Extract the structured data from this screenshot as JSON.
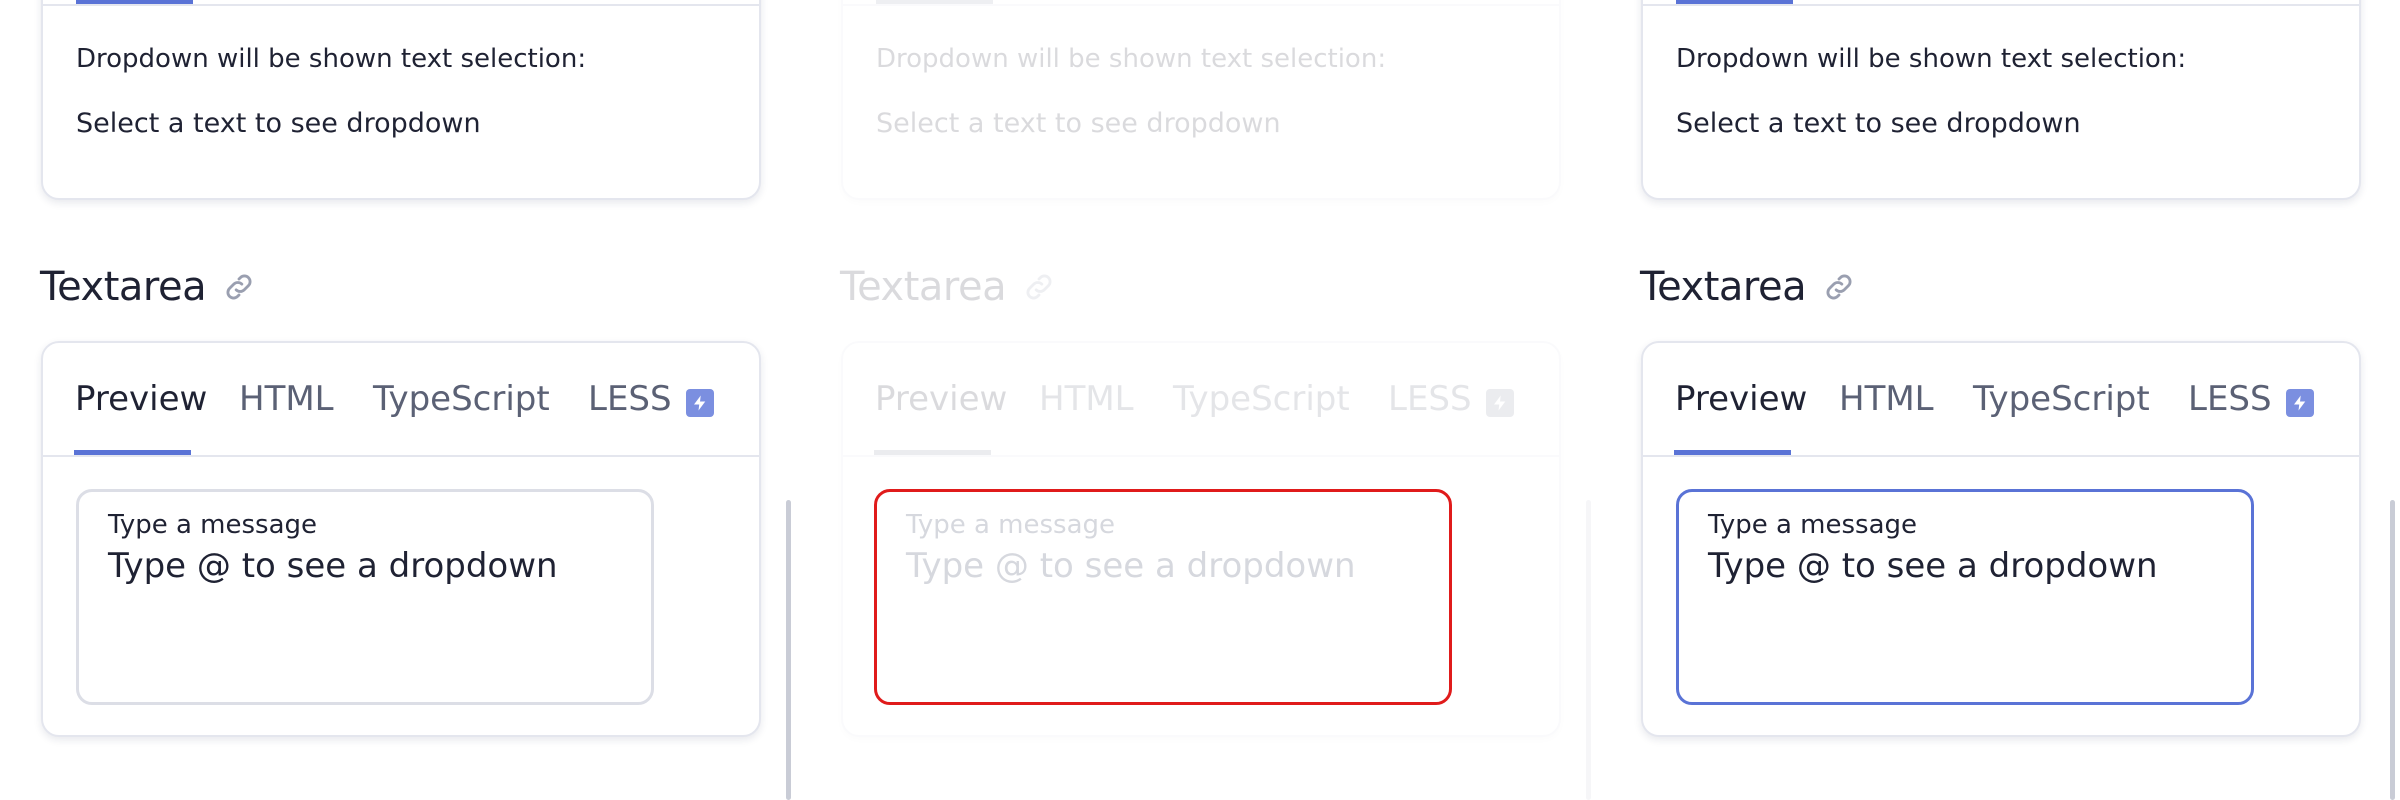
{
  "panels": [
    {
      "state": "default",
      "top_card": {
        "line1": "Dropdown will be shown text selection:",
        "line2": "Select a text to see dropdown"
      },
      "section_title": "Textarea",
      "tabs": [
        "Preview",
        "HTML",
        "TypeScript",
        "LESS"
      ],
      "active_tab": "Preview",
      "field": {
        "label": "Type a message",
        "placeholder": "Type @ to see a dropdown"
      }
    },
    {
      "state": "disabled-error",
      "top_card": {
        "line1": "Dropdown will be shown text selection:",
        "line2": "Select a text to see dropdown"
      },
      "section_title": "Textarea",
      "tabs": [
        "Preview",
        "HTML",
        "TypeScript",
        "LESS"
      ],
      "active_tab": "Preview",
      "field": {
        "label": "Type a message",
        "placeholder": "Type @ to see a dropdown"
      }
    },
    {
      "state": "focused",
      "top_card": {
        "line1": "Dropdown will be shown text selection:",
        "line2": "Select a text to see dropdown"
      },
      "section_title": "Textarea",
      "tabs": [
        "Preview",
        "HTML",
        "TypeScript",
        "LESS"
      ],
      "active_tab": "Preview",
      "field": {
        "label": "Type a message",
        "placeholder": "Type @ to see a dropdown"
      }
    }
  ],
  "colors": {
    "accent": "#5a73d6",
    "error": "#e01b1b",
    "border": "#e4e6ee",
    "badge": "#7b8fe0"
  }
}
